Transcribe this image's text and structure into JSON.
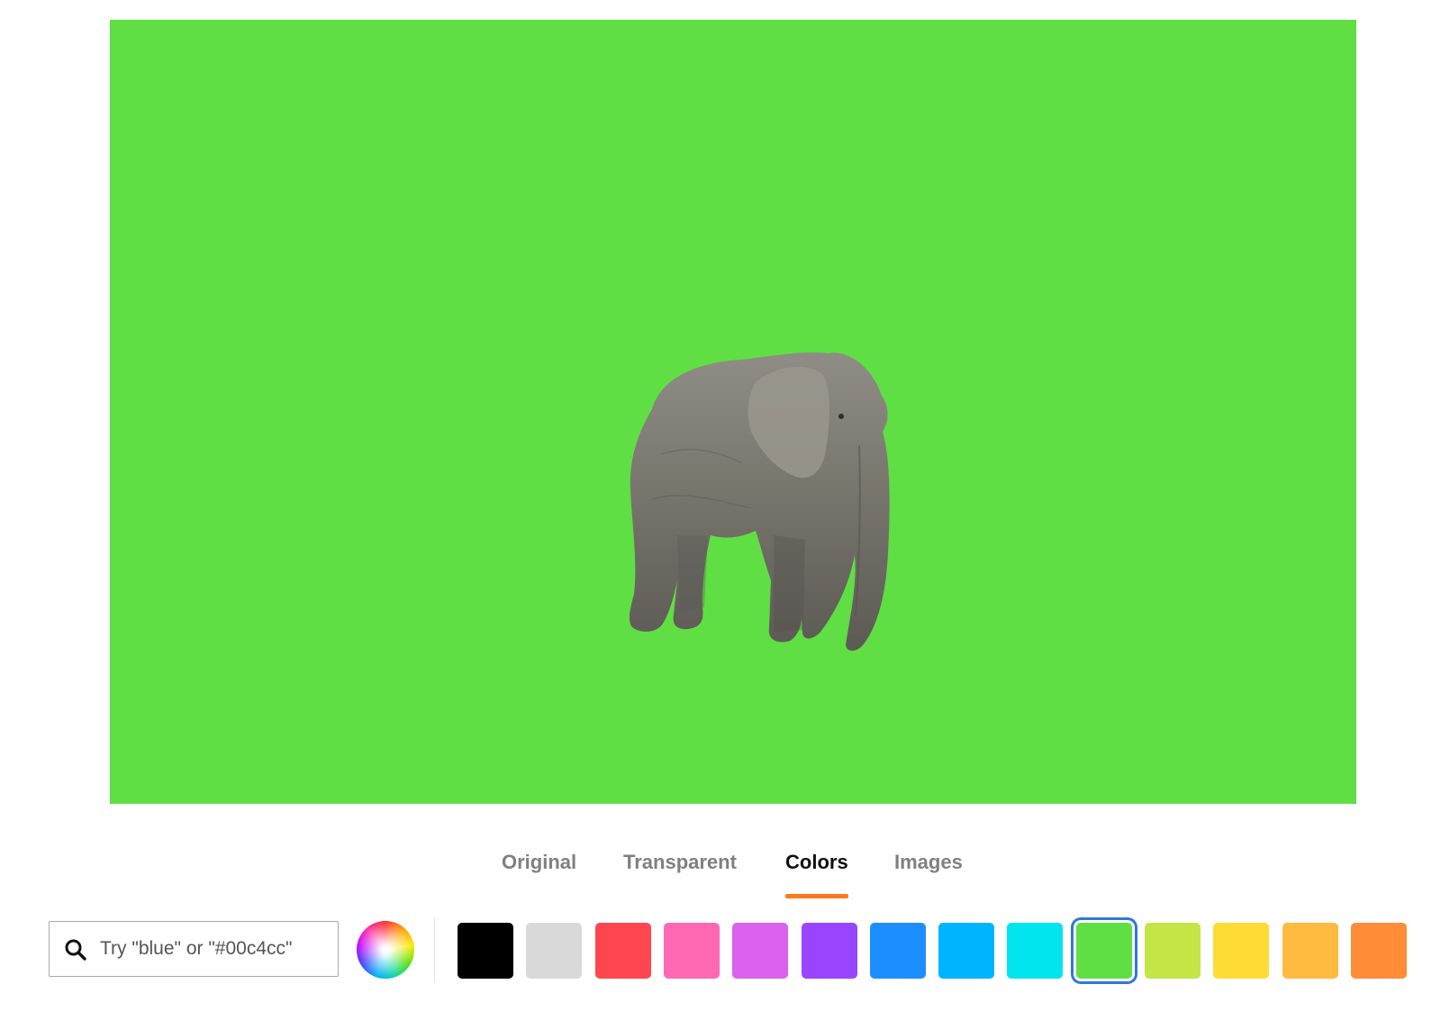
{
  "preview": {
    "background_color": "#5fdf44",
    "subject": "elephant cutout"
  },
  "tabs": [
    {
      "label": "Original",
      "active": false
    },
    {
      "label": "Transparent",
      "active": false
    },
    {
      "label": "Colors",
      "active": true
    },
    {
      "label": "Images",
      "active": false
    }
  ],
  "search": {
    "placeholder": "Try \"blue\" or \"#00c4cc\"",
    "value": "",
    "icon": "search-icon"
  },
  "color_picker": {
    "icon": "color-wheel-icon"
  },
  "swatches": [
    {
      "color": "#000000",
      "selected": false
    },
    {
      "color": "#d9d9d9",
      "selected": false
    },
    {
      "color": "#ff4650",
      "selected": false
    },
    {
      "color": "#ff69b4",
      "selected": false
    },
    {
      "color": "#da62ee",
      "selected": false
    },
    {
      "color": "#9945ff",
      "selected": false
    },
    {
      "color": "#1c8eff",
      "selected": false
    },
    {
      "color": "#00b4ff",
      "selected": false
    },
    {
      "color": "#00e5ee",
      "selected": false
    },
    {
      "color": "#5fdf44",
      "selected": true
    },
    {
      "color": "#c4e545",
      "selected": false
    },
    {
      "color": "#ffdc35",
      "selected": false
    },
    {
      "color": "#ffba40",
      "selected": false
    },
    {
      "color": "#ff8c36",
      "selected": false
    }
  ],
  "accent_color": "#ff7a1a",
  "selection_ring_color": "#2f79d8"
}
